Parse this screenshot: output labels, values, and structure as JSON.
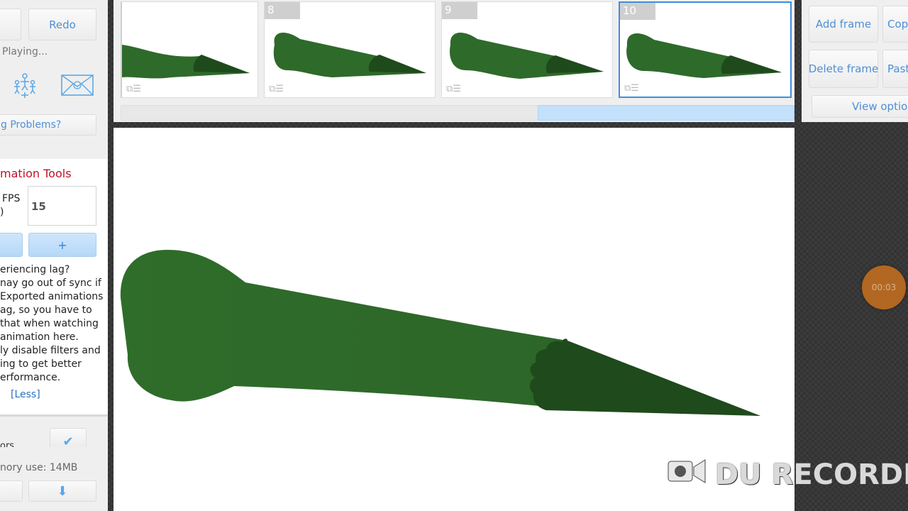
{
  "left_panel": {
    "undo_label": "",
    "redo_label": "Redo",
    "playing_status": "Playing...",
    "problems_link": "g Problems?",
    "animation_tools_heading": "mation Tools",
    "fps_label": "FPS",
    "fps_paren": ")",
    "fps_value": "15",
    "plus_label": "+",
    "lag_lines": [
      "eriencing lag?",
      "nay go out of sync if",
      "Exported animations",
      "ag, so you have to",
      "that when watching",
      "animation here.",
      "ly disable filters and",
      "ing to get better",
      "erformance."
    ],
    "less_link": "[Less]",
    "partial_label": "ors",
    "memory_use": "nory use: 14MB",
    "down_arrow": "⬇"
  },
  "timeline": {
    "frames": [
      {
        "number": "",
        "selected": false
      },
      {
        "number": "8",
        "selected": false
      },
      {
        "number": "9",
        "selected": false
      },
      {
        "number": "10",
        "selected": true
      }
    ],
    "scroll_position_fraction": 0.62
  },
  "right_panel": {
    "add_frame": "Add frame",
    "copy": "Cop",
    "delete_frame": "Delete frame",
    "paste": "Past",
    "view_options": "View option"
  },
  "overlay": {
    "rec_timer": "00:03",
    "watermark": "DU RECORDE"
  },
  "colors": {
    "accent_blue": "#4f8fd6",
    "heading_red": "#c0102a",
    "shape_green": "#2e6a2a",
    "shape_dark_green": "#1f4a1c"
  }
}
